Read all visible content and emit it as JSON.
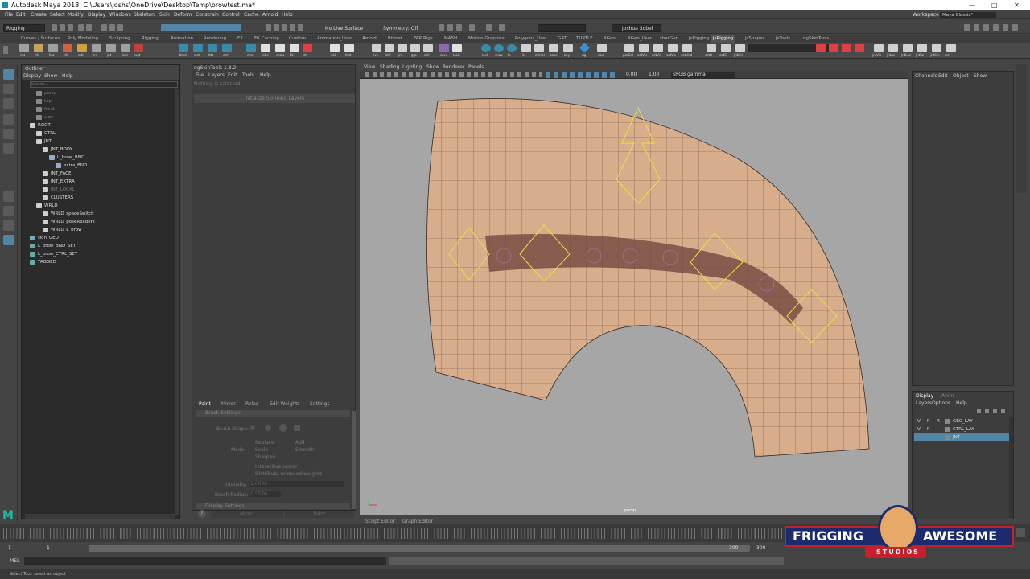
{
  "window": {
    "title": "Autodesk Maya 2018: C:\\Users\\joshs\\OneDrive\\Desktop\\Temp\\browtest.ma*"
  },
  "menubar": {
    "items": [
      "File",
      "Edit",
      "Create",
      "Select",
      "Modify",
      "Display",
      "Windows",
      "Skeleton",
      "Skin",
      "Deform",
      "Constrain",
      "Control",
      "Cache",
      "Arnold",
      "Help"
    ],
    "workspace_label": "Workspace :",
    "workspace_value": "Maya Classic*"
  },
  "statusline": {
    "mode": "Rigging",
    "live_surface": "No Live Surface",
    "symmetry": "Symmetry: Off",
    "user": "Joshua Sobel"
  },
  "shelf": {
    "tabs": [
      "Curves / Surfaces",
      "Poly Modeling",
      "Sculpting",
      "Rigging",
      "Animation",
      "Rendering",
      "FX",
      "FX Caching",
      "Custom",
      "Animation_User",
      "Arnold",
      "Bifrost",
      "FAR Rigs",
      "MASH",
      "Motion Graphics",
      "Polygons_User",
      "GAT",
      "TURTLE",
      "XGen",
      "XGen_User",
      "sharGen",
      "jsRigging",
      "jsRigging",
      "jsShapes",
      "jsTools",
      "ngSkinTools"
    ],
    "active_tab": "jsRigging",
    "buttons": [
      "nfo",
      "hfo",
      "hfo",
      "hfo",
      "mtl",
      "crv",
      "jnt",
      "skin",
      "wgt",
      "blnd",
      "clst",
      "lttc",
      "ctrl",
      "cnst",
      "hide",
      "show",
      "fz",
      "ctr",
      "del",
      "hist",
      "cvs",
      "ctrl",
      "jnt",
      "grp",
      "ctrl",
      "save",
      "load",
      "lock",
      "snap",
      "fk",
      "ik",
      "mirror",
      "bake",
      "key",
      "rig",
      "doc"
    ],
    "buttons2": [
      "parSel",
      "setVis",
      "setVis",
      "setVis",
      "setUnd",
      "setR",
      "setS",
      "jntOri",
      "jntVis",
      "jntAx",
      "jntLoc",
      "jntSz",
      "jntCln",
      "nrn"
    ]
  },
  "outliner": {
    "title": "Outliner",
    "menu": [
      "Display",
      "Show",
      "Help"
    ],
    "search_placeholder": "Search...",
    "items": [
      {
        "label": "persp",
        "depth": 1,
        "dim": true,
        "icon": "camera-icon"
      },
      {
        "label": "top",
        "depth": 1,
        "dim": true,
        "icon": "camera-icon"
      },
      {
        "label": "front",
        "depth": 1,
        "dim": true,
        "icon": "camera-icon"
      },
      {
        "label": "side",
        "depth": 1,
        "dim": true,
        "icon": "camera-icon"
      },
      {
        "label": "ROOT",
        "depth": 0,
        "dim": false,
        "icon": "group-icon"
      },
      {
        "label": "CTRL",
        "depth": 1,
        "dim": false,
        "icon": "group-icon"
      },
      {
        "label": "JNT",
        "depth": 1,
        "dim": false,
        "icon": "group-icon"
      },
      {
        "label": "JNT_BODY",
        "depth": 2,
        "dim": false,
        "icon": "group-icon"
      },
      {
        "label": "L_brow_BND",
        "depth": 3,
        "dim": false,
        "icon": "joint-icon"
      },
      {
        "label": "extra_BND",
        "depth": 4,
        "dim": false,
        "icon": "joint-icon"
      },
      {
        "label": "JNT_FACE",
        "depth": 2,
        "dim": false,
        "icon": "group-icon"
      },
      {
        "label": "JNT_EXTRA",
        "depth": 2,
        "dim": false,
        "icon": "group-icon"
      },
      {
        "label": "JNT_LOCAL",
        "depth": 2,
        "dim": true,
        "icon": "group-icon"
      },
      {
        "label": "CLUSTERS",
        "depth": 2,
        "dim": false,
        "icon": "group-icon"
      },
      {
        "label": "WRLD",
        "depth": 1,
        "dim": false,
        "icon": "group-icon"
      },
      {
        "label": "WRLD_spaceSwitch",
        "depth": 2,
        "dim": false,
        "icon": "group-icon"
      },
      {
        "label": "WRLD_poseReaders",
        "depth": 2,
        "dim": false,
        "icon": "group-icon"
      },
      {
        "label": "WRLD_L_brow",
        "depth": 2,
        "dim": false,
        "icon": "group-icon"
      },
      {
        "label": "skin_GEO",
        "depth": 0,
        "dim": false,
        "icon": "mesh-icon"
      },
      {
        "label": "L_brow_BND_SET",
        "depth": 0,
        "dim": false,
        "icon": "set-icon"
      },
      {
        "label": "L_brow_CTRL_SET",
        "depth": 0,
        "dim": false,
        "icon": "set-icon"
      },
      {
        "label": "TAGGED",
        "depth": 0,
        "dim": false,
        "icon": "set-icon"
      }
    ]
  },
  "ngskin": {
    "title": "ngSkinTools 1.8.2",
    "menu": [
      "File",
      "Layers",
      "Edit",
      "Tools",
      "Help"
    ],
    "status": "Nothing is selected",
    "init_button": "Initialize Skinning Layers",
    "tabs": [
      "Paint",
      "Mirror",
      "Relax",
      "Edit Weights",
      "Settings"
    ],
    "active_tab": "Paint",
    "section": "Brush Settings",
    "brush_shape_label": "Brush Shape:",
    "mode_label": "Mode:",
    "modes": [
      "Replace",
      "Add",
      "Scale",
      "Smooth",
      "Sharpen"
    ],
    "interactive_mirror": "Interactive mirror",
    "distribute": "Distribute removed weights",
    "intensity_label": "Intensity:",
    "intensity_value": "1.0000",
    "radius_label": "Brush Radius:",
    "radius_value": "0.5576",
    "display_section": "Display Settings",
    "mirror_button": "Mirror",
    "paint_button": "Paint"
  },
  "viewport": {
    "menu": [
      "View",
      "Shading",
      "Lighting",
      "Show",
      "Renderer",
      "Panels"
    ],
    "field_a": "0.00",
    "field_b": "1.00",
    "colorspace": "sRGB gamma",
    "camera_label": "persp",
    "bottom_tabs": [
      "Script Editor",
      "Graph Editor"
    ]
  },
  "channelbox": {
    "menu": [
      "Channels",
      "Edit",
      "Object",
      "Show"
    ]
  },
  "layers": {
    "tabs": [
      "Display",
      "Anim"
    ],
    "menu": [
      "Layers",
      "Options",
      "Help"
    ],
    "rows": [
      {
        "v": "V",
        "p": "P",
        "r": "R",
        "name": "GEO_LAY",
        "selected": false
      },
      {
        "v": "V",
        "p": "P",
        "r": "",
        "name": "CTRL_LAY",
        "selected": false
      },
      {
        "v": "",
        "p": "",
        "r": "",
        "name": "JNT",
        "selected": true
      }
    ]
  },
  "timeline": {
    "start": "1",
    "end_a": "300",
    "end_b": "300",
    "current": "1"
  },
  "cmdline": {
    "lang": "MEL"
  },
  "helpline": {
    "text": "Select Tool: select an object"
  },
  "watermark": {
    "left": "FRIGGING",
    "right": "AWESOME",
    "sub": "STUDIOS"
  }
}
